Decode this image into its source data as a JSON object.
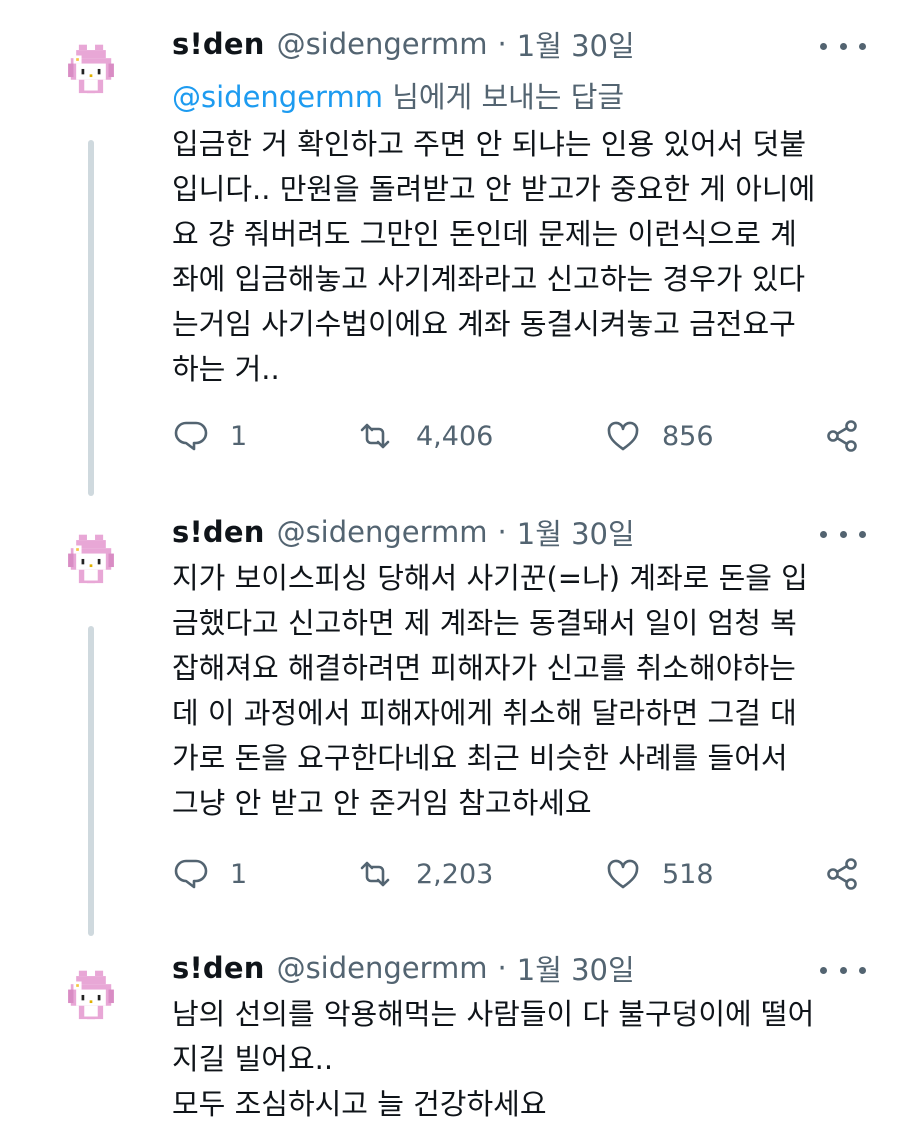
{
  "tweets": [
    {
      "author_name": "s!den",
      "author_handle": "@sidengermm",
      "separator": "·",
      "date": "1월 30일",
      "replying_mention": "@sidengermm",
      "replying_suffix": "님에게 보내는 답글",
      "body_lines": [
        "입금한 거 확인하고 주면 안 되냐는 인용 있어서 덧붙",
        "입니다.. 만원을 돌려받고 안 받고가 중요한 게 아니에",
        "요 걍 줘버려도 그만인 돈인데 문제는 이런식으로 계",
        "좌에 입금해놓고 사기계좌라고 신고하는 경우가 있다",
        "는거임 사기수법이에요 계좌 동결시켜놓고 금전요구",
        "하는 거.."
      ],
      "replies": "1",
      "retweets": "4,406",
      "likes": "856"
    },
    {
      "author_name": "s!den",
      "author_handle": "@sidengermm",
      "separator": "·",
      "date": "1월 30일",
      "body_lines": [
        "지가 보이스피싱 당해서 사기꾼(=나) 계좌로 돈을 입",
        "금했다고 신고하면 제 계좌는 동결돼서 일이 엄청 복",
        "잡해져요 해결하려면 피해자가 신고를 취소해야하는",
        "데 이 과정에서 피해자에게 취소해 달라하면 그걸 대",
        "가로 돈을 요구한다네요 최근 비슷한 사례를 들어서",
        "그냥 안 받고 안 준거임 참고하세요"
      ],
      "replies": "1",
      "retweets": "2,203",
      "likes": "518"
    },
    {
      "author_name": "s!den",
      "author_handle": "@sidengermm",
      "separator": "·",
      "date": "1월 30일",
      "body_lines": [
        "남의 선의를 악용해먹는 사람들이 다 불구덩이에 떨어",
        "지길 빌어요..",
        "모두 조심하시고 늘 건강하세요"
      ]
    }
  ],
  "icons": {
    "avatar": "my-melody-pixel-avatar",
    "reply": "speech-bubble-icon",
    "retweet": "retweet-icon",
    "like": "heart-icon",
    "share": "share-icon",
    "more": "more-dots-icon"
  },
  "colors": {
    "text": "#0f1419",
    "secondary": "#536471",
    "link": "#1d9bf0",
    "thread_line": "#cfd9de",
    "avatar_pink": "#e29ccf"
  }
}
